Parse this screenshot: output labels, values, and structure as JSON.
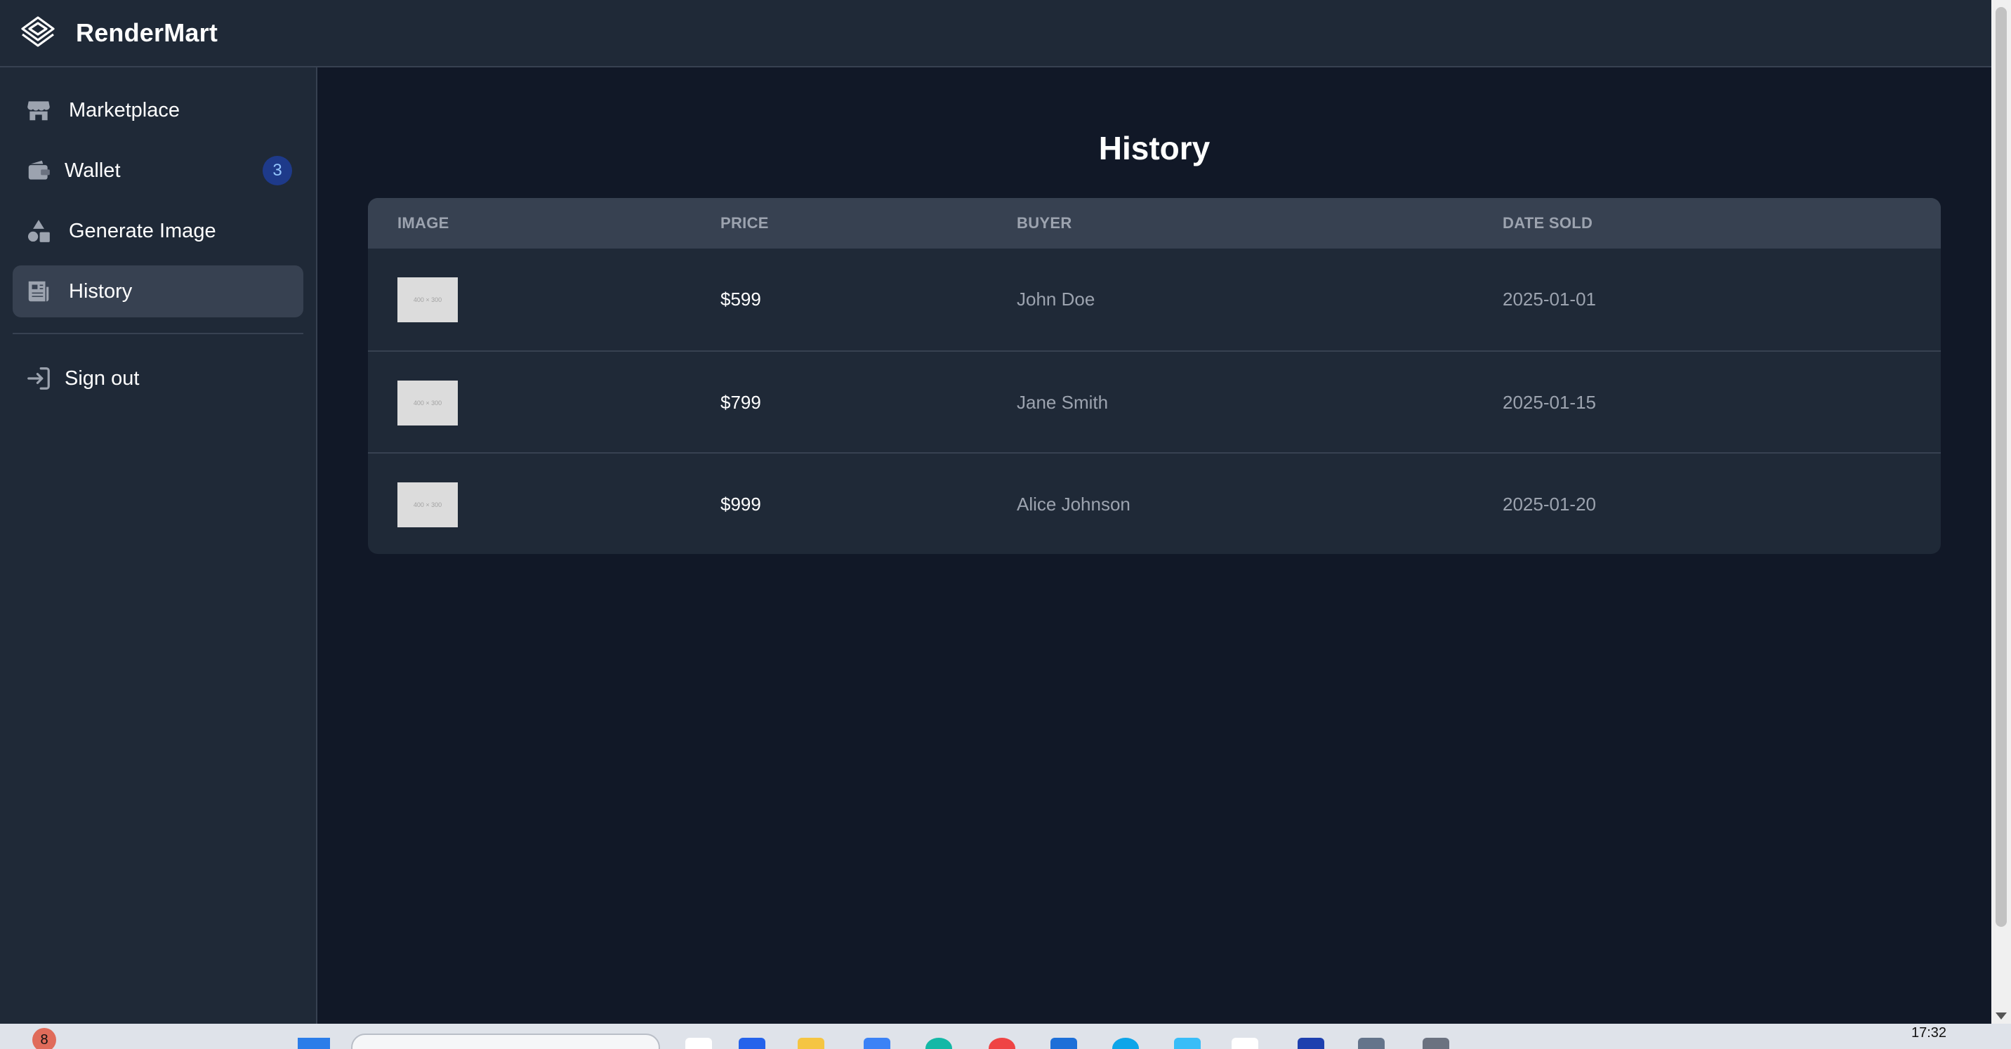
{
  "app": {
    "name": "RenderMart"
  },
  "sidebar": {
    "items": [
      {
        "label": "Marketplace",
        "icon": "store-icon"
      },
      {
        "label": "Wallet",
        "icon": "wallet-icon",
        "badge": "3"
      },
      {
        "label": "Generate Image",
        "icon": "shapes-icon"
      },
      {
        "label": "History",
        "icon": "newspaper-icon",
        "active": true
      }
    ],
    "signout": {
      "label": "Sign out",
      "icon": "sign-in-arrow-icon"
    }
  },
  "main": {
    "title": "History",
    "table": {
      "columns": [
        "Image",
        "Price",
        "Buyer",
        "Date Sold"
      ],
      "rows": [
        {
          "image": "400 × 300",
          "price": "$599",
          "buyer": "John Doe",
          "date": "2025-01-01"
        },
        {
          "image": "400 × 300",
          "price": "$799",
          "buyer": "Jane Smith",
          "date": "2025-01-15"
        },
        {
          "image": "400 × 300",
          "price": "$999",
          "buyer": "Alice Johnson",
          "date": "2025-01-20"
        }
      ]
    }
  },
  "taskbar": {
    "notification_count": "8",
    "time": "17:32"
  },
  "colors": {
    "background": "#111827",
    "panel": "#1f2937",
    "header_row": "#374151",
    "badge": "#1e3a8a"
  }
}
